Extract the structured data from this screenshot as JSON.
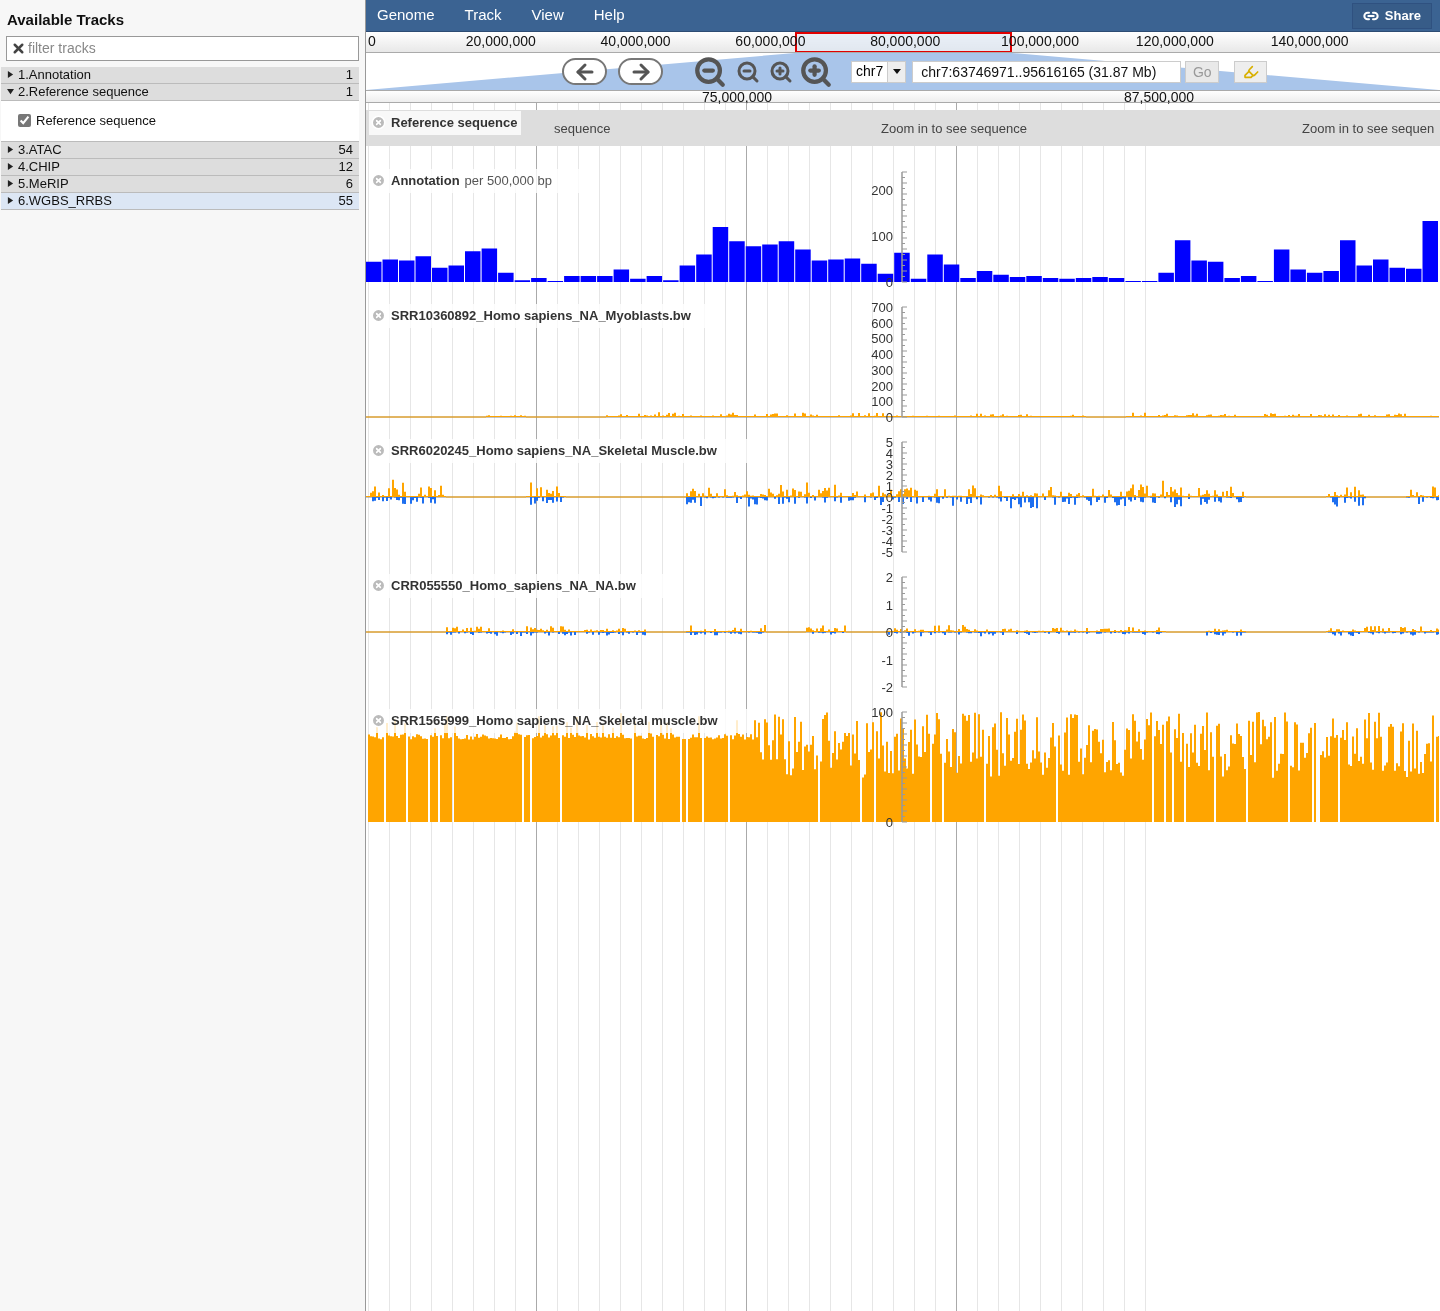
{
  "sidebar": {
    "title": "Available Tracks",
    "filter": {
      "placeholder": "filter tracks"
    },
    "categories": [
      {
        "label": "1.Annotation",
        "count": "1",
        "expanded": false,
        "selected": false
      },
      {
        "label": "2.Reference sequence",
        "count": "1",
        "expanded": true,
        "selected": false,
        "tracks": [
          {
            "label": "Reference sequence",
            "checked": true
          }
        ]
      },
      {
        "label": "3.ATAC",
        "count": "54",
        "expanded": false,
        "selected": false
      },
      {
        "label": "4.CHIP",
        "count": "12",
        "expanded": false,
        "selected": false
      },
      {
        "label": "5.MeRIP",
        "count": "6",
        "expanded": false,
        "selected": false
      },
      {
        "label": "6.WGBS_RRBS",
        "count": "55",
        "expanded": false,
        "selected": true
      }
    ]
  },
  "menu": [
    "Genome",
    "Track",
    "View",
    "Help"
  ],
  "share": "Share",
  "overview": {
    "ticks": [
      "0",
      "20,000,000",
      "40,000,000",
      "60,000,000",
      "80,000,000",
      "100,000,000",
      "120,000,000",
      "140,000,000"
    ]
  },
  "navigation": {
    "chromosome": "chr7",
    "location": "chr7:63746971..95616165 (31.87 Mb)",
    "go": "Go"
  },
  "ruler": [
    "75,000,000",
    "87,500,000"
  ],
  "tracks": [
    {
      "kind": "sequence",
      "name": "Reference sequence",
      "messages": [
        "sequence",
        "Zoom in to see sequence",
        "Zoom in to see sequen"
      ]
    },
    {
      "kind": "histogram",
      "name": "Annotation",
      "detail": "per 500,000 bp",
      "yticks": [
        "200",
        "100",
        "0"
      ]
    },
    {
      "kind": "signal",
      "name": "SRR10360892_Homo sapiens_NA_Myoblasts.bw",
      "yticks": [
        "700",
        "600",
        "500",
        "400",
        "300",
        "200",
        "100",
        "0"
      ]
    },
    {
      "kind": "signal",
      "name": "SRR6020245_Homo sapiens_NA_Skeletal Muscle.bw",
      "yticks": [
        "5",
        "4",
        "3",
        "2",
        "1",
        "0",
        "-1",
        "-2",
        "-3",
        "-4",
        "-5"
      ]
    },
    {
      "kind": "signal",
      "name": "CRR055550_Homo_sapiens_NA_NA.bw",
      "yticks": [
        "2",
        "1",
        "0",
        "-1",
        "-2"
      ]
    },
    {
      "kind": "dense",
      "name": "SRR1565999_Homo sapiens_NA_Skeletal muscle.bw",
      "yticks": [
        "100",
        "0"
      ]
    }
  ]
}
